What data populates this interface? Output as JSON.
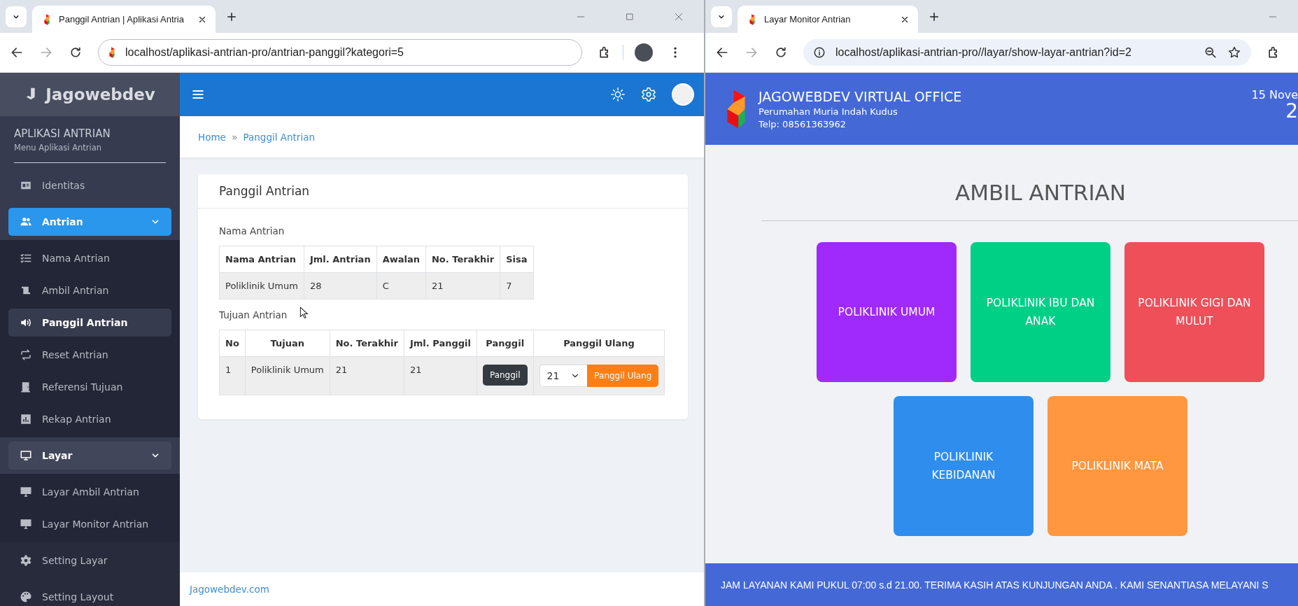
{
  "left_window": {
    "tab": {
      "title": "Panggil Antrian | Aplikasi Antria"
    },
    "url": "localhost/aplikasi-antrian-pro/antrian-panggil?kategori=5",
    "brand": "Jagowebdev",
    "sidebar": {
      "title": "APLIKASI ANTRIAN",
      "subtitle": "Menu Aplikasi Antrian",
      "items": [
        {
          "label": "Identitas",
          "selected": false
        },
        {
          "label": "Antrian",
          "selected": true,
          "expanded": true,
          "children": [
            {
              "label": "Nama Antrian",
              "selected": false
            },
            {
              "label": "Ambil Antrian",
              "selected": false
            },
            {
              "label": "Panggil Antrian",
              "selected": true
            },
            {
              "label": "Reset Antrian",
              "selected": false
            },
            {
              "label": "Referensi Tujuan",
              "selected": false
            },
            {
              "label": "Rekap Antrian",
              "selected": false
            }
          ]
        },
        {
          "label": "Layar",
          "selected": false,
          "expanded": true,
          "children": [
            {
              "label": "Layar Ambil Antrian",
              "selected": false
            },
            {
              "label": "Layar Monitor Antrian",
              "selected": false
            }
          ]
        },
        {
          "label": "Setting Layar",
          "selected": false
        },
        {
          "label": "Setting Layout",
          "selected": false
        }
      ]
    },
    "breadcrumb": {
      "items": [
        "Home",
        "Panggil Antrian"
      ],
      "separator": "»"
    },
    "card": {
      "title": "Panggil Antrian",
      "queue_table": {
        "caption": "Nama Antrian",
        "columns": [
          "Nama Antrian",
          "Jml. Antrian",
          "Awalan",
          "No. Terakhir",
          "Sisa"
        ],
        "rows": [
          [
            "Poliklinik Umum",
            "28",
            "C",
            "21",
            "7"
          ]
        ]
      },
      "destination_table": {
        "caption": "Tujuan Antrian",
        "columns": [
          "No",
          "Tujuan",
          "No. Terakhir",
          "Jml. Panggil",
          "Panggil",
          "Panggil Ulang"
        ],
        "rows": [
          {
            "cells": [
              "1",
              "Poliklinik Umum",
              "21",
              "21"
            ],
            "call_button": "Panggil",
            "recall_value": "21",
            "recall_button": "Panggil Ulang"
          }
        ]
      }
    },
    "footer": "Jagowebdev.com"
  },
  "right_window": {
    "tab": {
      "title": "Layar Monitor Antrian"
    },
    "url": "localhost/aplikasi-antrian-pro//layar/show-layar-antrian?id=2",
    "header": {
      "name": "JAGOWEBDEV VIRTUAL OFFICE",
      "address": "Perumahan Muria Indah Kudus",
      "phone": "Telp: 08561363962",
      "date": "15 Nove",
      "time": "2"
    },
    "title": "AMBIL ANTRIAN",
    "tiles": [
      {
        "label": "POLIKLINIK UMUM",
        "color": "#a029fb"
      },
      {
        "label": "POLIKLINIK IBU DAN ANAK",
        "color": "#00cf86"
      },
      {
        "label": "POLIKLINIK GIGI DAN MULUT",
        "color": "#ee4f59"
      },
      {
        "label": "POLIKLINIK KEBIDANAN",
        "color": "#2f8ded"
      },
      {
        "label": "POLIKLINIK MATA",
        "color": "#fe973f"
      }
    ],
    "running_text": "JAM LAYANAN KAMI PUKUL 07:00 s.d 21.00. TERIMA KASIH ATAS KUNJUNGAN ANDA . KAMI SENANTIASA MELAYANI S"
  }
}
